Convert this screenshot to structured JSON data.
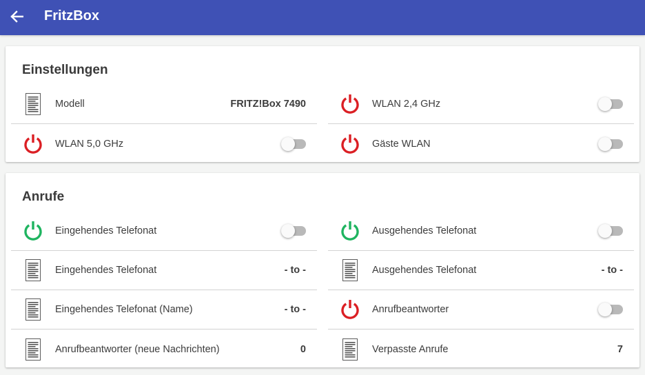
{
  "appbar": {
    "title": "FritzBox",
    "back_icon": "arrow-left-icon"
  },
  "colors": {
    "primary": "#3f51b5",
    "power_off": "#db1f24",
    "power_on": "#1fb460"
  },
  "einstellungen": {
    "title": "Einstellungen",
    "rows": [
      {
        "label": "Modell",
        "icon": "document-icon",
        "value": "FRITZ!Box 7490"
      },
      {
        "label": "WLAN 2,4 GHz",
        "icon": "power-icon",
        "state": "off",
        "toggle": false
      },
      {
        "label": "WLAN 5,0 GHz",
        "icon": "power-icon",
        "state": "off",
        "toggle": false
      },
      {
        "label": "Gäste WLAN",
        "icon": "power-icon",
        "state": "off",
        "toggle": false
      }
    ]
  },
  "anrufe": {
    "title": "Anrufe",
    "rows": [
      {
        "label": "Eingehendes Telefonat",
        "icon": "power-icon",
        "state": "on",
        "toggle": false
      },
      {
        "label": "Ausgehendes Telefonat",
        "icon": "power-icon",
        "state": "on",
        "toggle": false
      },
      {
        "label": "Eingehendes Telefonat",
        "icon": "document-icon",
        "value": "- to -"
      },
      {
        "label": "Ausgehendes Telefonat",
        "icon": "document-icon",
        "value": "- to -"
      },
      {
        "label": "Eingehendes Telefonat (Name)",
        "icon": "document-icon",
        "value": "- to -"
      },
      {
        "label": "Anrufbeantworter",
        "icon": "power-icon",
        "state": "off",
        "toggle": false
      },
      {
        "label": "Anrufbeantworter (neue Nachrichten)",
        "icon": "document-icon",
        "value": "0"
      },
      {
        "label": "Verpasste Anrufe",
        "icon": "document-icon",
        "value": "7"
      }
    ]
  }
}
